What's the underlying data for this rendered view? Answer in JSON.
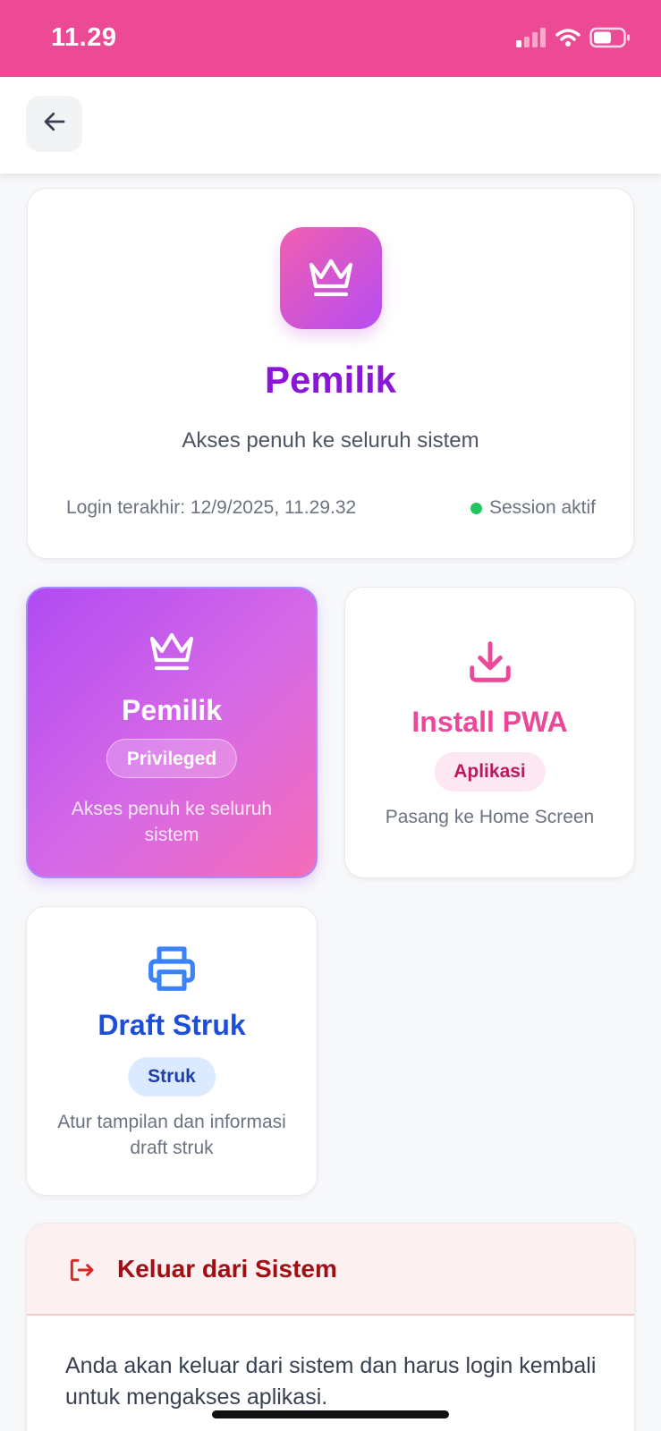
{
  "status_bar": {
    "time": "11.29",
    "icons": [
      "signal-icon",
      "wifi-icon",
      "battery-icon"
    ],
    "color": "#ec4a94"
  },
  "header": {
    "back_icon": "arrow-left-icon"
  },
  "profile": {
    "icon": "crown-icon",
    "title": "Pemilik",
    "subtitle": "Akses penuh ke seluruh sistem",
    "last_login": "Login terakhir: 12/9/2025, 11.29.32",
    "session_status": "Session aktif",
    "session_color": "#22c55e"
  },
  "tiles": {
    "owner": {
      "icon": "crown-icon",
      "title": "Pemilik",
      "badge": "Privileged",
      "description": "Akses penuh ke seluruh sistem"
    },
    "pwa": {
      "icon": "download-icon",
      "title": "Install PWA",
      "badge": "Aplikasi",
      "description": "Pasang ke Home Screen",
      "accent": "#ec4899"
    },
    "draft": {
      "icon": "printer-icon",
      "title": "Draft Struk",
      "badge": "Struk",
      "description": "Atur tampilan dan informasi draft struk",
      "accent": "#1d4ed8"
    }
  },
  "logout": {
    "icon": "logout-icon",
    "title": "Keluar dari Sistem",
    "text": "Anda akan keluar dari sistem dan harus login kembali untuk mengakses aplikasi."
  }
}
